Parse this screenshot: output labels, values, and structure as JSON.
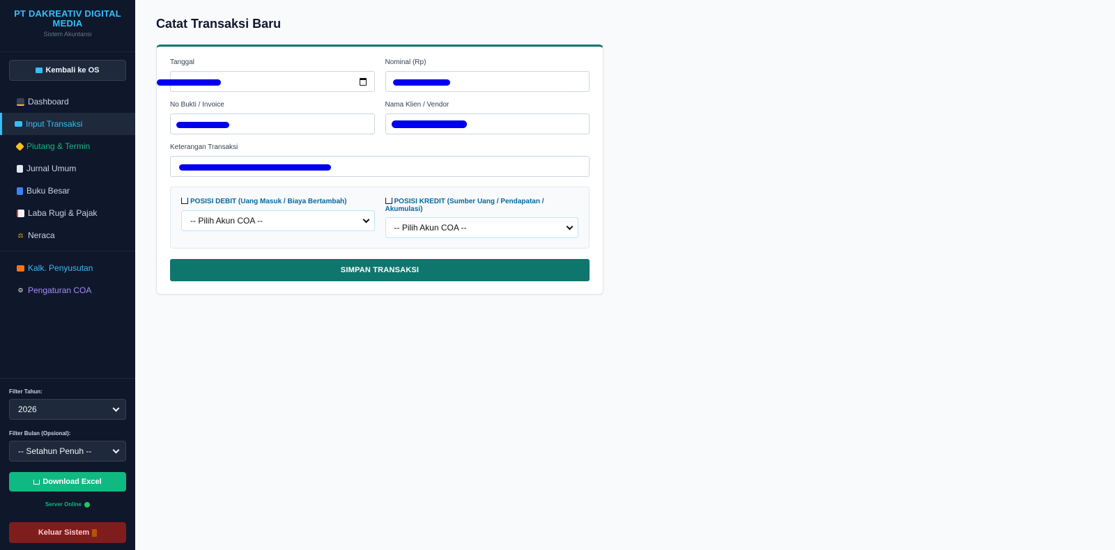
{
  "sidebar": {
    "brand_title": "PT DAKREATIV DIGITAL MEDIA",
    "brand_subtitle": "Sistem Akuntansi",
    "back_label": "Kembali ke OS",
    "items": [
      {
        "label": "Dashboard",
        "icon": "chart-icon",
        "color": "#cbd5e1"
      },
      {
        "label": "Input Transaksi",
        "icon": "card-icon",
        "color": "#38bdf8",
        "active": true
      },
      {
        "label": "Piutang & Termin",
        "icon": "tag-icon",
        "color": "#10b981"
      },
      {
        "label": "Jurnal Umum",
        "icon": "ledger-icon",
        "color": "#cbd5e1"
      },
      {
        "label": "Buku Besar",
        "icon": "book-icon",
        "color": "#cbd5e1"
      },
      {
        "label": "Laba Rugi & Pajak",
        "icon": "trend-icon",
        "color": "#cbd5e1"
      },
      {
        "label": "Neraca",
        "icon": "scale-icon",
        "color": "#cbd5e1"
      }
    ],
    "extra_items": [
      {
        "label": "Kalk. Penyusutan",
        "icon": "abacus-icon",
        "color": "#38bdf8"
      },
      {
        "label": "Pengaturan COA",
        "icon": "gear-icon",
        "color": "#a78bfa"
      }
    ],
    "filter_year_label": "Filter Tahun:",
    "filter_year_value": "2026",
    "filter_month_label": "Filter Bulan (Opsional):",
    "filter_month_value": "-- Setahun Penuh --",
    "download_label": "Download Excel",
    "server_status": "Server Online",
    "logout_label": "Keluar Sistem"
  },
  "main": {
    "title": "Catat Transaksi Baru",
    "fields": {
      "tanggal_label": "Tanggal",
      "nominal_label": "Nominal (Rp)",
      "bukti_label": "No Bukti / Invoice",
      "klien_label": "Nama Klien / Vendor",
      "keterangan_label": "Keterangan Transaksi"
    },
    "debit_label": "POSISI DEBIT (Uang Masuk / Biaya Bertambah)",
    "kredit_label": "POSISI KREDIT (Sumber Uang / Pendapatan / Akumulasi)",
    "debit_value": "-- Pilih Akun COA --",
    "kredit_value": "-- Pilih Akun COA --",
    "save_label": "SIMPAN TRANSAKSI"
  },
  "colors": {
    "sidebar_bg": "#0f172a",
    "accent": "#0f766e",
    "download": "#10b981",
    "logout": "#7f1d1d"
  }
}
